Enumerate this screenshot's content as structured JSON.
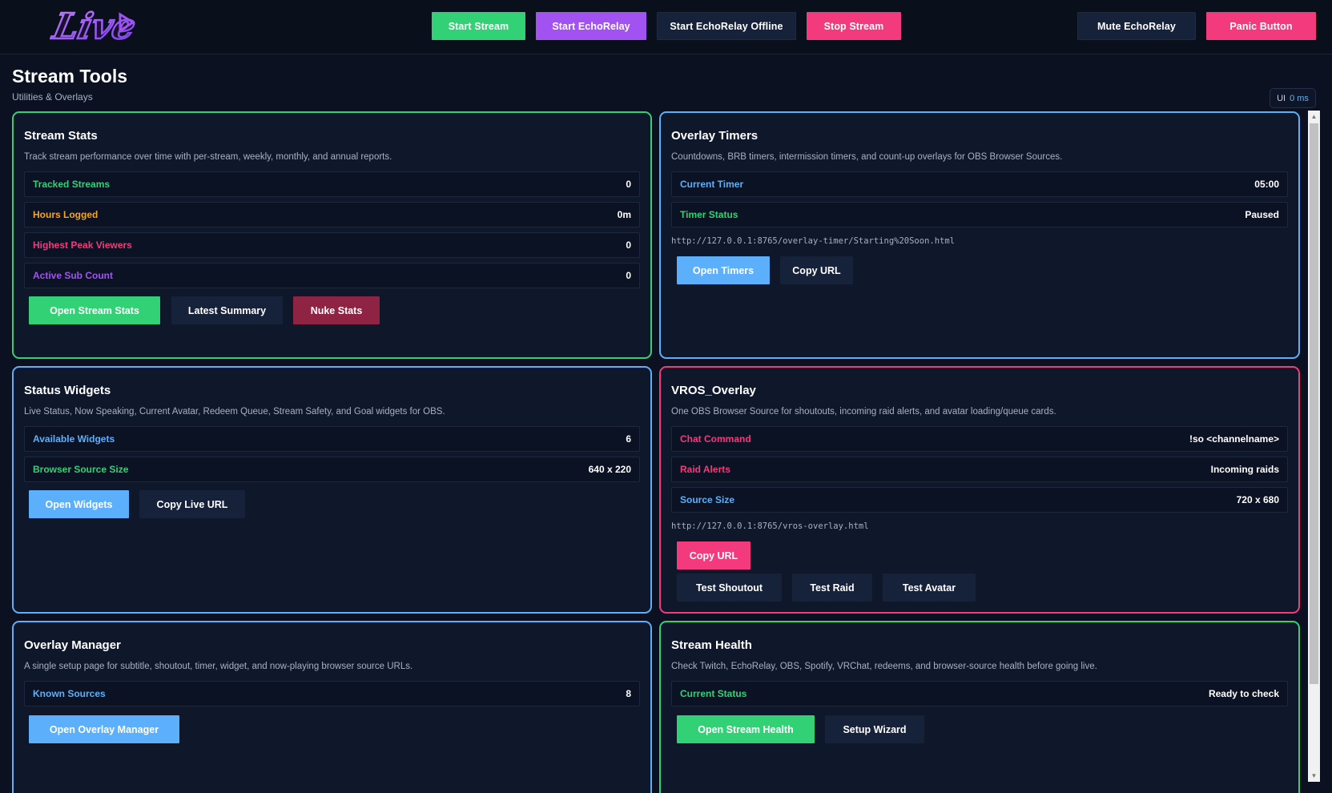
{
  "header": {
    "logo_text": "Live",
    "buttons": {
      "start_stream": "Start Stream",
      "start_echorelay": "Start EchoRelay",
      "start_echorelay_offline": "Start EchoRelay Offline",
      "stop_stream": "Stop Stream",
      "mute_echorelay": "Mute EchoRelay",
      "panic_button": "Panic Button"
    }
  },
  "page": {
    "title": "Stream Tools",
    "subtitle": "Utilities & Overlays",
    "ui_badge": {
      "label": "UI",
      "value": "0 ms"
    }
  },
  "cards": {
    "stream_stats": {
      "title": "Stream Stats",
      "description": "Track stream performance over time with per-stream, weekly, monthly, and annual reports.",
      "rows": [
        {
          "label": "Tracked Streams",
          "value": "0"
        },
        {
          "label": "Hours Logged",
          "value": "0m"
        },
        {
          "label": "Highest Peak Viewers",
          "value": "0"
        },
        {
          "label": "Active Sub Count",
          "value": "0"
        }
      ],
      "buttons": {
        "open": "Open Stream Stats",
        "latest": "Latest Summary",
        "nuke": "Nuke Stats"
      }
    },
    "overlay_timers": {
      "title": "Overlay Timers",
      "description": "Countdowns, BRB timers, intermission timers, and count-up overlays for OBS Browser Sources.",
      "rows": [
        {
          "label": "Current Timer",
          "value": "05:00"
        },
        {
          "label": "Timer Status",
          "value": "Paused"
        }
      ],
      "url": "http://127.0.0.1:8765/overlay-timer/Starting%20Soon.html",
      "buttons": {
        "open": "Open Timers",
        "copy": "Copy URL"
      }
    },
    "status_widgets": {
      "title": "Status Widgets",
      "description": "Live Status, Now Speaking, Current Avatar, Redeem Queue, Stream Safety, and Goal widgets for OBS.",
      "rows": [
        {
          "label": "Available Widgets",
          "value": "6"
        },
        {
          "label": "Browser Source Size",
          "value": "640 x 220"
        }
      ],
      "buttons": {
        "open": "Open Widgets",
        "copy": "Copy Live URL"
      }
    },
    "vros_overlay": {
      "title": "VROS_Overlay",
      "description": "One OBS Browser Source for shoutouts, incoming raid alerts, and avatar loading/queue cards.",
      "rows": [
        {
          "label": "Chat Command",
          "value": "!so <channelname>"
        },
        {
          "label": "Raid Alerts",
          "value": "Incoming raids"
        },
        {
          "label": "Source Size",
          "value": "720 x 680"
        }
      ],
      "url": "http://127.0.0.1:8765/vros-overlay.html",
      "buttons": {
        "copy": "Copy URL",
        "test_shoutout": "Test Shoutout",
        "test_raid": "Test Raid",
        "test_avatar": "Test Avatar"
      }
    },
    "overlay_manager": {
      "title": "Overlay Manager",
      "description": "A single setup page for subtitle, shoutout, timer, widget, and now-playing browser source URLs.",
      "rows": [
        {
          "label": "Known Sources",
          "value": "8"
        }
      ],
      "buttons": {
        "open": "Open Overlay Manager"
      }
    },
    "stream_health": {
      "title": "Stream Health",
      "description": "Check Twitch, EchoRelay, OBS, Spotify, VRChat, redeems, and browser-source health before going live.",
      "rows": [
        {
          "label": "Current Status",
          "value": "Ready to check"
        }
      ],
      "buttons": {
        "open": "Open Stream Health",
        "wizard": "Setup Wizard"
      }
    }
  },
  "colors": {
    "green": "#33d176",
    "purple": "#a352f2",
    "pink": "#f23a7d",
    "blue": "#5cb0fb",
    "orange": "#f5a524",
    "maroon": "#8f2344",
    "background": "#0b1120"
  }
}
